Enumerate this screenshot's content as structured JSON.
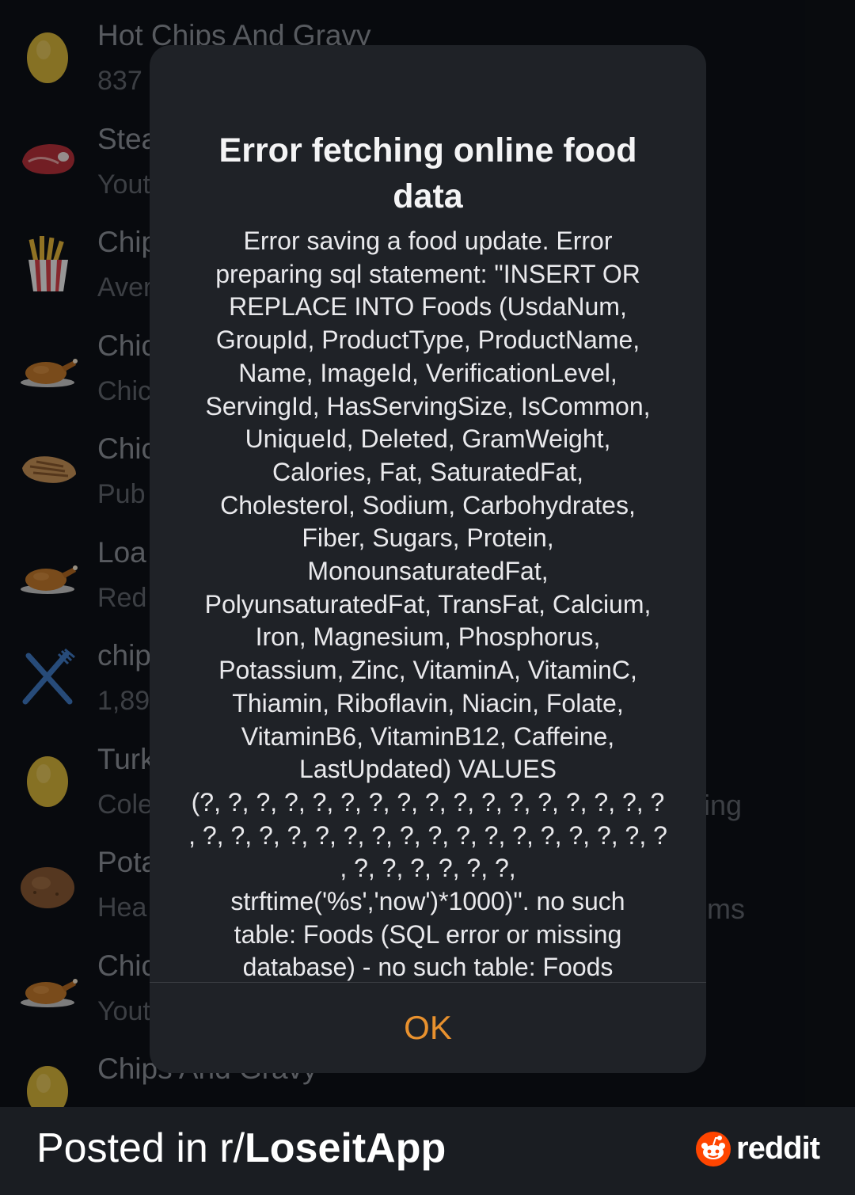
{
  "food_list": [
    {
      "name": "Hot Chips And Gravy",
      "sub": "837",
      "icon": "potato-icon"
    },
    {
      "name": "Stea",
      "sub": "Yout",
      "icon": "steak-icon"
    },
    {
      "name": "Chip",
      "sub": "Aver",
      "icon": "fries-icon"
    },
    {
      "name": "Chic",
      "sub": "Chic",
      "icon": "roast-chicken-icon"
    },
    {
      "name": "Chic",
      "sub": "Pub",
      "icon": "chicken-breast-icon"
    },
    {
      "name": "Loa",
      "sub": "Red",
      "icon": "roast-chicken-icon"
    },
    {
      "name": "chip",
      "sub": "1,89",
      "icon": "fork-knife-icon"
    },
    {
      "name": "Turk",
      "sub": "Cole",
      "icon": "potato-icon"
    },
    {
      "name": "Pota",
      "sub": "Hea",
      "icon": "baked-potato-icon"
    },
    {
      "name": "Chic",
      "sub": "Yout",
      "icon": "roast-chicken-icon"
    },
    {
      "name": "Chips And Gravy",
      "sub": "",
      "icon": "potato-icon"
    }
  ],
  "right_fragments": [
    "ing",
    "ms"
  ],
  "alert": {
    "title": "Error fetching online food data",
    "message": "Error saving a food update. Error\npreparing sql statement: \"INSERT OR\nREPLACE INTO Foods (UsdaNum,\nGroupId, ProductType, ProductName,\nName, ImageId, VerificationLevel,\nServingId, HasServingSize, IsCommon,\nUniqueId, Deleted, GramWeight,\nCalories, Fat, SaturatedFat,\nCholesterol, Sodium, Carbohydrates,\nFiber, Sugars, Protein,\nMonounsaturatedFat,\nPolyunsaturatedFat, TransFat, Calcium,\nIron, Magnesium, Phosphorus,\nPotassium, Zinc, VitaminA, VitaminC,\nThiamin, Riboflavin, Niacin, Folate,\nVitaminB6, VitaminB12, Caffeine,\nLastUpdated) VALUES\n(?, ?, ?, ?, ?, ?, ?, ?, ?, ?, ?, ?, ?, ?, ?, ?, ?\n, ?, ?, ?, ?, ?, ?, ?, ?, ?, ?, ?, ?, ?, ?, ?, ?, ?\n, ?, ?, ?, ?, ?, ?,\nstrftime('%s','now')*1000)\". no such\ntable: Foods (SQL error or missing\ndatabase) - no such table: Foods",
    "ok_label": "OK",
    "accent_color": "#e8912e"
  },
  "footer": {
    "posted_prefix": "Posted in r/",
    "subreddit": "LoseitApp",
    "brand": "reddit",
    "brand_color": "#ff4500"
  }
}
